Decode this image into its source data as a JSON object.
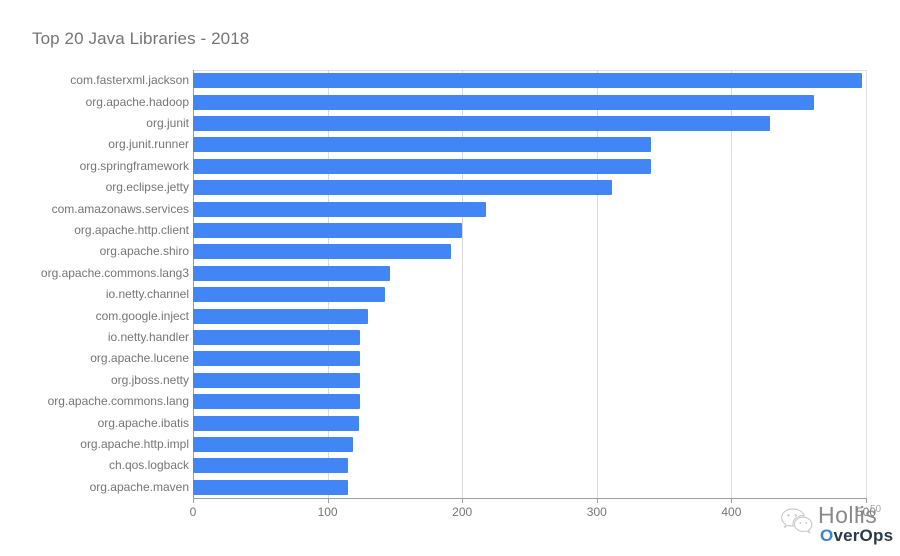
{
  "chart_data": {
    "type": "bar",
    "orientation": "horizontal",
    "title": "Top 20 Java Libraries - 2018",
    "subtitle": "",
    "xlabel": "",
    "ylabel": "",
    "xlim": [
      0,
      500
    ],
    "ylim": null,
    "grid": true,
    "legend": false,
    "legend_position": "none",
    "bar_color": "#4285f4",
    "categories": [
      "com.fasterxml.jackson",
      "org.apache.hadoop",
      "org.junit",
      "org.junit.runner",
      "org.springframework",
      "org.eclipse.jetty",
      "com.amazonaws.services",
      "org.apache.http.client",
      "org.apache.shiro",
      "org.apache.commons.lang3",
      "io.netty.channel",
      "com.google.inject",
      "io.netty.handler",
      "org.apache.lucene",
      "org.jboss.netty",
      "org.apache.commons.lang",
      "org.apache.ibatis",
      "org.apache.http.impl",
      "ch.qos.logback",
      "org.apache.maven"
    ],
    "values": [
      497,
      461,
      429,
      340,
      340,
      311,
      218,
      200,
      192,
      146,
      143,
      130,
      124,
      124,
      124,
      124,
      123,
      119,
      115,
      115
    ],
    "xticks": [
      0,
      100,
      200,
      300,
      400,
      500
    ],
    "xtick_labels": [
      "0",
      "100",
      "200",
      "300",
      "400",
      "500"
    ]
  },
  "watermark": {
    "brand": "Hollis",
    "superscript": "50",
    "sub_brand_prefix": "O",
    "sub_brand_rest": "verOps",
    "icon": "wechat-icon"
  }
}
